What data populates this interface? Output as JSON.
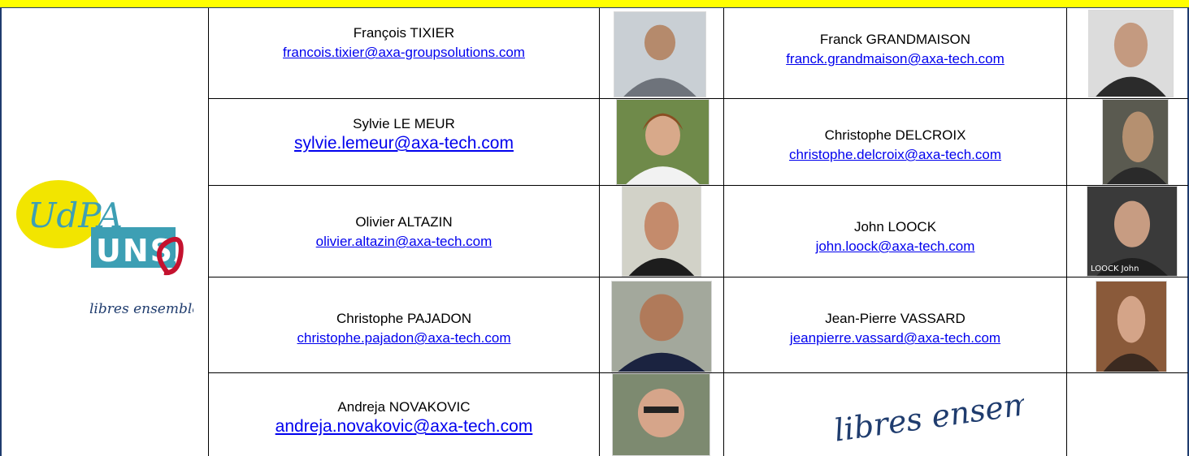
{
  "colors": {
    "header_band": "#ffff00",
    "frame": "#1f3c6e",
    "link": "#0000ee",
    "logo_yellow": "#f2e500",
    "logo_teal": "#3d9fb4",
    "logo_red": "#c4122f"
  },
  "logo": {
    "uda": "UdPA",
    "unsa": "UNSA",
    "tagline": "libres ensemble"
  },
  "people": [
    {
      "name": "François TIXIER",
      "email": "francois.tixier@axa-groupsolutions.com"
    },
    {
      "name": "Franck GRANDMAISON",
      "email": "franck.grandmaison@axa-tech.com"
    },
    {
      "name": "Sylvie LE MEUR",
      "email": "sylvie.lemeur@axa-tech.com"
    },
    {
      "name": "Christophe DELCROIX",
      "email": "christophe.delcroix@axa-tech.com"
    },
    {
      "name": "Olivier ALTAZIN",
      "email": "olivier.altazin@axa-tech.com"
    },
    {
      "name": "John LOOCK",
      "email": "john.loock@axa-tech.com",
      "photo_caption": "LOOCK John"
    },
    {
      "name": "Christophe PAJADON",
      "email": "christophe.pajadon@axa-tech.com"
    },
    {
      "name": "Jean-Pierre VASSARD",
      "email": "jeanpierre.vassard@axa-tech.com"
    },
    {
      "name": "Andreja NOVAKOVIC",
      "email": "andreja.novakovic@axa-tech.com"
    }
  ],
  "signature": "libres ensemble"
}
